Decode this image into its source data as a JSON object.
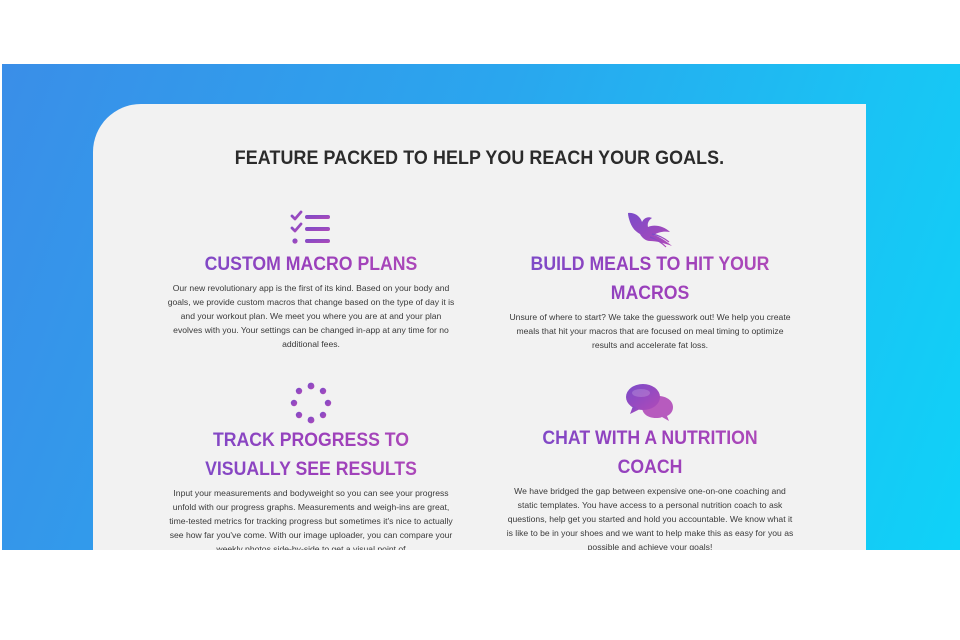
{
  "section": {
    "title": "FEATURE PACKED TO HELP YOU REACH YOUR GOALS."
  },
  "features": [
    {
      "icon": "checklist-icon",
      "heading": "CUSTOM MACRO PLANS",
      "body": "Our new revolutionary app is the first of its kind. Based on your body and goals, we provide custom macros that change based on the type of day it is and your workout plan. We meet you where you are at and your plan evolves with you. Your settings can be changed in-app at any time for no additional fees."
    },
    {
      "icon": "phoenix-icon",
      "heading": "BUILD MEALS TO HIT YOUR MACROS",
      "body": "Unsure of where to start? We take the guesswork out! We help you create meals that hit your macros that are focused on meal timing to optimize results and accelerate fat loss."
    },
    {
      "icon": "spinner-icon",
      "heading": "TRACK PROGRESS TO VISUALLY SEE RESULTS",
      "body": "Input your measurements and bodyweight so you can see your progress unfold with our progress graphs. Measurements and weigh-ins are great, time-tested metrics for tracking progress but sometimes it's nice to actually see how far you've come. With our image uploader, you can compare your weekly photos side-by-side to get a visual point of"
    },
    {
      "icon": "chat-bubbles-icon",
      "heading": "CHAT WITH A NUTRITION COACH",
      "body": "We have bridged the gap between expensive one-on-one coaching and static templates. You have access to a personal nutrition coach to ask questions, help get you started and hold you accountable. We know what it is like to be in your shoes and we want to help make this as easy for you as possible and achieve your goals!"
    }
  ],
  "colors": {
    "accent": "#9b3fba",
    "gradient_start": "#3a8ee8",
    "gradient_end": "#0fd2f8",
    "card_bg": "#f2f2f2",
    "title_text": "#2b2b2b"
  }
}
